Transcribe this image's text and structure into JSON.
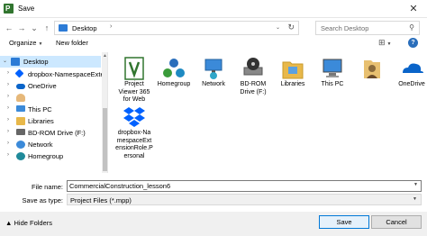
{
  "window": {
    "title": "Save",
    "close_glyph": "✕"
  },
  "address": {
    "back_glyph": "←",
    "forward_glyph": "→",
    "recent_glyph": "⌄",
    "up_glyph": "↑",
    "path": "Desktop",
    "sep": "›",
    "dropdown_glyph": "⌄",
    "refresh_glyph": "↻"
  },
  "search": {
    "placeholder": "Search Desktop",
    "icon_glyph": "⚲"
  },
  "toolbar": {
    "organize_label": "Organize",
    "organize_dd": "▼",
    "new_folder_label": "New folder",
    "view_glyph": "⊞",
    "view_dd": "▼",
    "help_glyph": "?"
  },
  "nav": {
    "items": [
      {
        "label": "Desktop",
        "caret": "⌄",
        "color": "#2c7bd6"
      },
      {
        "label": "dropbox-NamespaceExten",
        "caret": "›",
        "color": "#0061fe"
      },
      {
        "label": "OneDrive",
        "caret": "›",
        "color": "#0a64c9"
      },
      {
        "label": "",
        "caret": "›",
        "color": "#e6b87a"
      },
      {
        "label": "This PC",
        "caret": "›",
        "color": "#3b8ad9"
      },
      {
        "label": "Libraries",
        "caret": "›",
        "color": "#e8b84a"
      },
      {
        "label": "BD-ROM Drive (F:)",
        "caret": "›",
        "color": "#666666"
      },
      {
        "label": "Network",
        "caret": "›",
        "color": "#3b8ad9"
      },
      {
        "label": "Homegroup",
        "caret": "›",
        "color": "#1f8a9a"
      }
    ],
    "scroll_up_glyph": "▲"
  },
  "files": [
    {
      "label": "Project Viewer 365 for Web",
      "icon": "project-viewer-icon"
    },
    {
      "label": "Homegroup",
      "icon": "homegroup-icon"
    },
    {
      "label": "Network",
      "icon": "network-icon"
    },
    {
      "label": "BD-ROM Drive (F:)",
      "icon": "bd-rom-drive-icon"
    },
    {
      "label": "Libraries",
      "icon": "libraries-icon"
    },
    {
      "label": "This PC",
      "icon": "this-pc-icon"
    },
    {
      "label": "",
      "icon": "user-folder-icon"
    },
    {
      "label": "OneDrive",
      "icon": "onedrive-icon"
    },
    {
      "label": "dropbox-NamespaceExtensionRole.Personal",
      "icon": "dropbox-icon"
    }
  ],
  "form": {
    "file_name_label": "File name:",
    "file_name_value": "CommercialConstruction_lesson6",
    "save_type_label": "Save as type:",
    "save_type_value": "Project Files (*.mpp)",
    "dd_glyph": "▼"
  },
  "footer": {
    "hide_folders_label": "▲ Hide Folders",
    "save_label": "Save",
    "cancel_label": "Cancel"
  }
}
